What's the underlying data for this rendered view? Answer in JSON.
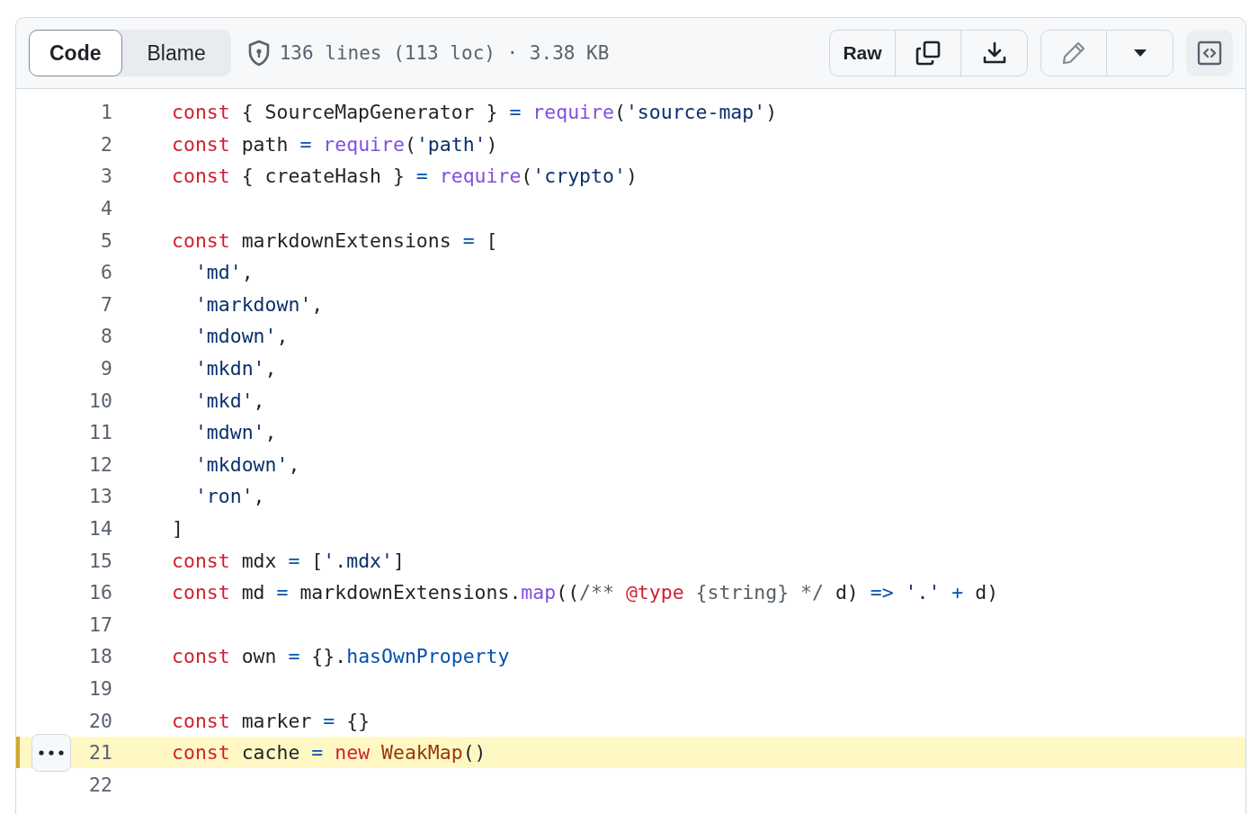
{
  "tabs": [
    {
      "label": "Code",
      "selected": true
    },
    {
      "label": "Blame",
      "selected": false
    }
  ],
  "file_info": "136 lines (113 loc) · 3.38 KB",
  "actions": {
    "raw": "Raw"
  },
  "lines": [
    {
      "number": "1",
      "highlighted": false,
      "tokens": [
        {
          "kind": "kw",
          "text": "const"
        },
        {
          "kind": "plain",
          "text": " { SourceMapGenerator } "
        },
        {
          "kind": "op",
          "text": "="
        },
        {
          "kind": "fn",
          "text": " require"
        },
        {
          "kind": "plain",
          "text": "("
        },
        {
          "kind": "str",
          "text": "'source-map'"
        },
        {
          "kind": "plain",
          "text": ")"
        }
      ]
    },
    {
      "number": "2",
      "highlighted": false,
      "tokens": [
        {
          "kind": "kw",
          "text": "const"
        },
        {
          "kind": "plain",
          "text": " path "
        },
        {
          "kind": "op",
          "text": "="
        },
        {
          "kind": "fn",
          "text": " require"
        },
        {
          "kind": "plain",
          "text": "("
        },
        {
          "kind": "str",
          "text": "'path'"
        },
        {
          "kind": "plain",
          "text": ")"
        }
      ]
    },
    {
      "number": "3",
      "highlighted": false,
      "tokens": [
        {
          "kind": "kw",
          "text": "const"
        },
        {
          "kind": "plain",
          "text": " { createHash } "
        },
        {
          "kind": "op",
          "text": "="
        },
        {
          "kind": "fn",
          "text": " require"
        },
        {
          "kind": "plain",
          "text": "("
        },
        {
          "kind": "str",
          "text": "'crypto'"
        },
        {
          "kind": "plain",
          "text": ")"
        }
      ]
    },
    {
      "number": "4",
      "highlighted": false
    },
    {
      "number": "5",
      "highlighted": false,
      "tokens": [
        {
          "kind": "kw",
          "text": "const"
        },
        {
          "kind": "plain",
          "text": " markdownExtensions "
        },
        {
          "kind": "op",
          "text": "="
        },
        {
          "kind": "plain",
          "text": " ["
        }
      ]
    },
    {
      "number": "6",
      "highlighted": false,
      "tokens": [
        {
          "kind": "str",
          "text": "  'md'"
        },
        {
          "kind": "plain",
          "text": ","
        }
      ]
    },
    {
      "number": "7",
      "highlighted": false,
      "tokens": [
        {
          "kind": "str",
          "text": "  'markdown'"
        },
        {
          "kind": "plain",
          "text": ","
        }
      ]
    },
    {
      "number": "8",
      "highlighted": false,
      "tokens": [
        {
          "kind": "str",
          "text": "  'mdown'"
        },
        {
          "kind": "plain",
          "text": ","
        }
      ]
    },
    {
      "number": "9",
      "highlighted": false,
      "tokens": [
        {
          "kind": "str",
          "text": "  'mkdn'"
        },
        {
          "kind": "plain",
          "text": ","
        }
      ]
    },
    {
      "number": "10",
      "highlighted": false,
      "tokens": [
        {
          "kind": "str",
          "text": "  'mkd'"
        },
        {
          "kind": "plain",
          "text": ","
        }
      ]
    },
    {
      "number": "11",
      "highlighted": false,
      "tokens": [
        {
          "kind": "str",
          "text": "  'mdwn'"
        },
        {
          "kind": "plain",
          "text": ","
        }
      ]
    },
    {
      "number": "12",
      "highlighted": false,
      "tokens": [
        {
          "kind": "str",
          "text": "  'mkdown'"
        },
        {
          "kind": "plain",
          "text": ","
        }
      ]
    },
    {
      "number": "13",
      "highlighted": false,
      "tokens": [
        {
          "kind": "str",
          "text": "  'ron'"
        },
        {
          "kind": "plain",
          "text": ","
        }
      ]
    },
    {
      "number": "14",
      "highlighted": false,
      "tokens": [
        {
          "kind": "plain",
          "text": "]"
        }
      ]
    },
    {
      "number": "15",
      "highlighted": false,
      "tokens": [
        {
          "kind": "kw",
          "text": "const"
        },
        {
          "kind": "plain",
          "text": " mdx "
        },
        {
          "kind": "op",
          "text": "="
        },
        {
          "kind": "plain",
          "text": " ["
        },
        {
          "kind": "str",
          "text": "'.mdx'"
        },
        {
          "kind": "plain",
          "text": "]"
        }
      ]
    },
    {
      "number": "16",
      "highlighted": false,
      "tokens": [
        {
          "kind": "kw",
          "text": "const"
        },
        {
          "kind": "plain",
          "text": " md "
        },
        {
          "kind": "op",
          "text": "="
        },
        {
          "kind": "plain",
          "text": " markdownExtensions."
        },
        {
          "kind": "fn",
          "text": "map"
        },
        {
          "kind": "plain",
          "text": "(("
        },
        {
          "kind": "comment",
          "text": "/** "
        },
        {
          "kind": "kw",
          "text": "@type"
        },
        {
          "kind": "comment",
          "text": " {string} */"
        },
        {
          "kind": "plain",
          "text": " d) "
        },
        {
          "kind": "op",
          "text": "=>"
        },
        {
          "kind": "str",
          "text": " '.' "
        },
        {
          "kind": "op",
          "text": "+"
        },
        {
          "kind": "plain",
          "text": " d)"
        }
      ]
    },
    {
      "number": "17",
      "highlighted": false
    },
    {
      "number": "18",
      "highlighted": false,
      "tokens": [
        {
          "kind": "kw",
          "text": "const"
        },
        {
          "kind": "plain",
          "text": " own "
        },
        {
          "kind": "op",
          "text": "="
        },
        {
          "kind": "plain",
          "text": " {}."
        },
        {
          "kind": "prop",
          "text": "hasOwnProperty"
        }
      ]
    },
    {
      "number": "19",
      "highlighted": false
    },
    {
      "number": "20",
      "highlighted": false,
      "tokens": [
        {
          "kind": "kw",
          "text": "const"
        },
        {
          "kind": "plain",
          "text": " marker "
        },
        {
          "kind": "op",
          "text": "="
        },
        {
          "kind": "plain",
          "text": " {}"
        }
      ]
    },
    {
      "number": "21",
      "highlighted": true,
      "tokens": [
        {
          "kind": "kw",
          "text": "const"
        },
        {
          "kind": "plain",
          "text": " cache "
        },
        {
          "kind": "op",
          "text": "="
        },
        {
          "kind": "kw",
          "text": " new"
        },
        {
          "kind": "cls",
          "text": " WeakMap"
        },
        {
          "kind": "plain",
          "text": "()"
        }
      ]
    },
    {
      "number": "22",
      "highlighted": false
    }
  ]
}
